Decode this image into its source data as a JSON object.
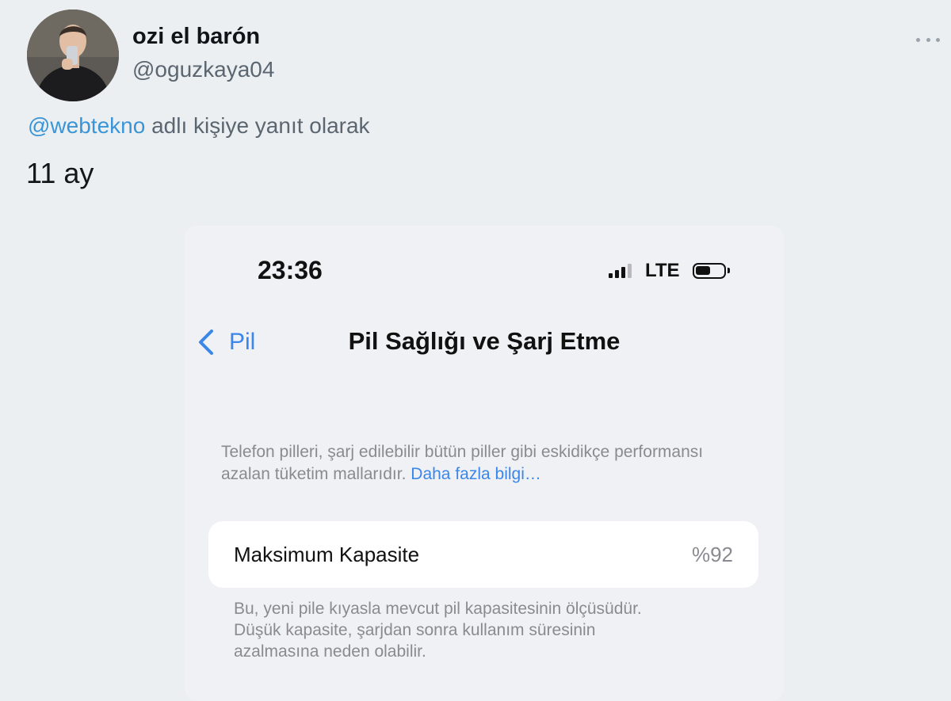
{
  "tweet": {
    "display_name": "ozi el barón",
    "handle": "@oguzkaya04",
    "reply_to_mention": "@webtekno",
    "reply_to_suffix": " adlı kişiye yanıt olarak",
    "text": "11 ay"
  },
  "screenshot": {
    "status_bar": {
      "time": "23:36",
      "network": "LTE",
      "signal_bars_filled": 3,
      "signal_bars_total": 4
    },
    "nav": {
      "back_label": "Pil",
      "title": "Pil Sağlığı ve Şarj Etme"
    },
    "description": "Telefon pilleri, şarj edilebilir bütün piller gibi eskidikçe performansı azalan tüketim mallarıdır.",
    "learn_more": "Daha fazla bilgi…",
    "capacity": {
      "label": "Maksimum Kapasite",
      "value": "%92"
    },
    "footnote_lines": [
      "Bu, yeni pile kıyasla mevcut pil kapasitesinin ölçüsüdür.",
      "Düşük kapasite, şarjdan sonra kullanım süresinin",
      "azalmasına neden olabilir."
    ]
  },
  "colors": {
    "page_background": "#eceff2",
    "mention_blue": "#3a95d7",
    "ios_blue": "#3a86e9",
    "secondary_text": "#5b6670"
  }
}
